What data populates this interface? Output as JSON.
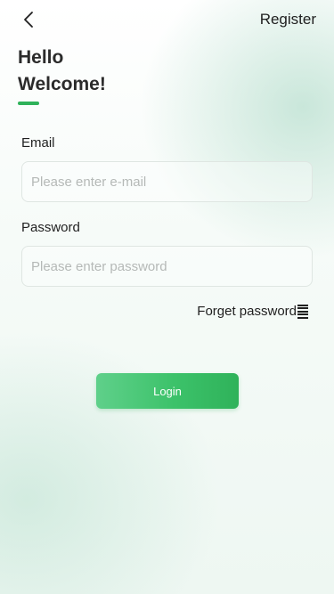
{
  "header": {
    "back_icon": "chevron-left-icon",
    "register_label": "Register"
  },
  "greeting": {
    "line1": "Hello",
    "line2": "Welcome!"
  },
  "form": {
    "email": {
      "label": "Email",
      "value": "",
      "placeholder": "Please enter e-mail"
    },
    "password": {
      "label": "Password",
      "value": "",
      "placeholder": "Please enter password"
    },
    "forget_label": "Forget password",
    "forget_icon": "menu-lines-icon",
    "login_label": "Login"
  },
  "colors": {
    "accent": "#2fb25a",
    "button_gradient_start": "#5fd08a",
    "button_gradient_end": "#2fb25a",
    "text": "#1f1f1f",
    "placeholder": "#b5b9b7"
  }
}
